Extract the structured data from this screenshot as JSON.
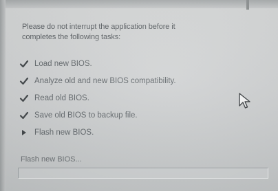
{
  "dialog": {
    "intro_line1": "Please do not interrupt the application before it",
    "intro_line2": "completes the following tasks:"
  },
  "tasks": [
    {
      "label": "Load new BIOS.",
      "state": "done",
      "icon": "checkmark-icon"
    },
    {
      "label": "Analyze old and new BIOS compatibility.",
      "state": "done",
      "icon": "checkmark-icon"
    },
    {
      "label": "Read old BIOS.",
      "state": "done",
      "icon": "checkmark-icon"
    },
    {
      "label": "Save old BIOS to backup file.",
      "state": "done",
      "icon": "checkmark-icon"
    },
    {
      "label": "Flash new BIOS.",
      "state": "in-progress",
      "icon": "triangle-right-icon"
    }
  ],
  "status": {
    "label": "Flash new BIOS...",
    "progress_percent": 0
  },
  "colors": {
    "text": "#5b6064",
    "icon": "#3f4447",
    "progress_fill": "#4a7cc7"
  },
  "cursor": {
    "icon": "mouse-pointer-icon"
  }
}
